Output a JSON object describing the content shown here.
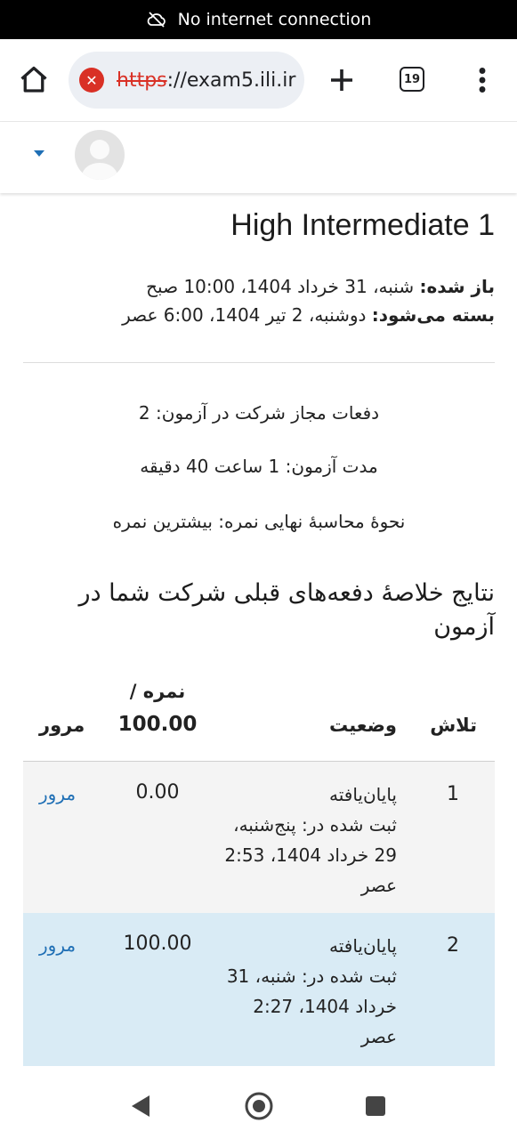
{
  "status_bar": {
    "message": "No internet connection"
  },
  "browser": {
    "url_scheme": "https",
    "url_rest": "://exam5.ili.ir",
    "tab_count": "19"
  },
  "quiz": {
    "title": "High Intermediate 1",
    "opened_label": "باز شده:",
    "opened_value": " شنبه، 31 خرداد 1404، 10:00 صبح",
    "closes_label": "بسته می‌شود:",
    "closes_value": " دوشنبه، 2 تیر 1404، 6:00 عصر",
    "attempts_allowed": "دفعات مجاز شرکت در آزمون: 2",
    "time_limit": "مدت آزمون: 1 ساعت 40 دقیقه",
    "grading_method": "نحوهٔ محاسبهٔ نهایی نمره: بیشترین نمره",
    "summary_heading": "نتایج خلاصهٔ دفعه‌های قبلی شرکت شما در آزمون"
  },
  "table": {
    "headers": {
      "attempt": "تلاش",
      "state": "وضعیت",
      "grade_line1": "نمره /",
      "grade_line2": "100.00",
      "review": "مرور"
    },
    "rows": [
      {
        "attempt": "1",
        "state": "پایان‌یافته",
        "submitted_lines": [
          "ثبت شده در: پنج‌شنبه،",
          "29 خرداد 1404، 2:53",
          "عصر"
        ],
        "grade": "0.00",
        "review": "مرور"
      },
      {
        "attempt": "2",
        "state": "پایان‌یافته",
        "submitted_lines": [
          "ثبت شده در: شنبه، 31",
          "خرداد 1404، 2:27",
          "عصر"
        ],
        "grade": "100.00",
        "review": "مرور"
      }
    ]
  },
  "colors": {
    "link": "#1f6fb5",
    "row_highlight": "#d9ebf5",
    "error_red": "#d93025"
  }
}
